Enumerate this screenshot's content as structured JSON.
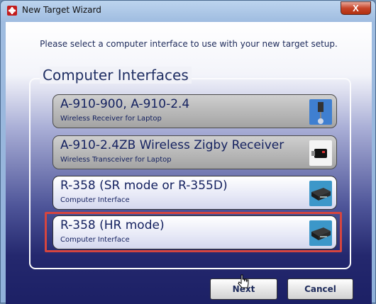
{
  "window": {
    "title": "New Target Wizard",
    "close_label": "X"
  },
  "prompt": "Please select a computer interface to use with your new target setup.",
  "group": {
    "title": "Computer Interfaces"
  },
  "options": [
    {
      "name": "A-910-900, A-910-2.4",
      "description": "Wireless Receiver for Laptop",
      "state": "disabled",
      "icon": "wireless-receiver-icon"
    },
    {
      "name": "A-910-2.4ZB Wireless Zigby Receiver",
      "description": "Wireless Transceiver for Laptop",
      "state": "disabled",
      "icon": "usb-transceiver-icon"
    },
    {
      "name": "R-358 (SR mode or R-355D)",
      "description": "Computer Interface",
      "state": "enabled",
      "icon": "interface-box-icon"
    },
    {
      "name": "R-358 (HR mode)",
      "description": "Computer Interface",
      "state": "enabled",
      "selected": true,
      "icon": "interface-box-icon"
    }
  ],
  "buttons": {
    "next": "Next",
    "cancel": "Cancel"
  },
  "colors": {
    "highlight": "#d6453f",
    "text": "#152260",
    "close": "#c7452a"
  }
}
